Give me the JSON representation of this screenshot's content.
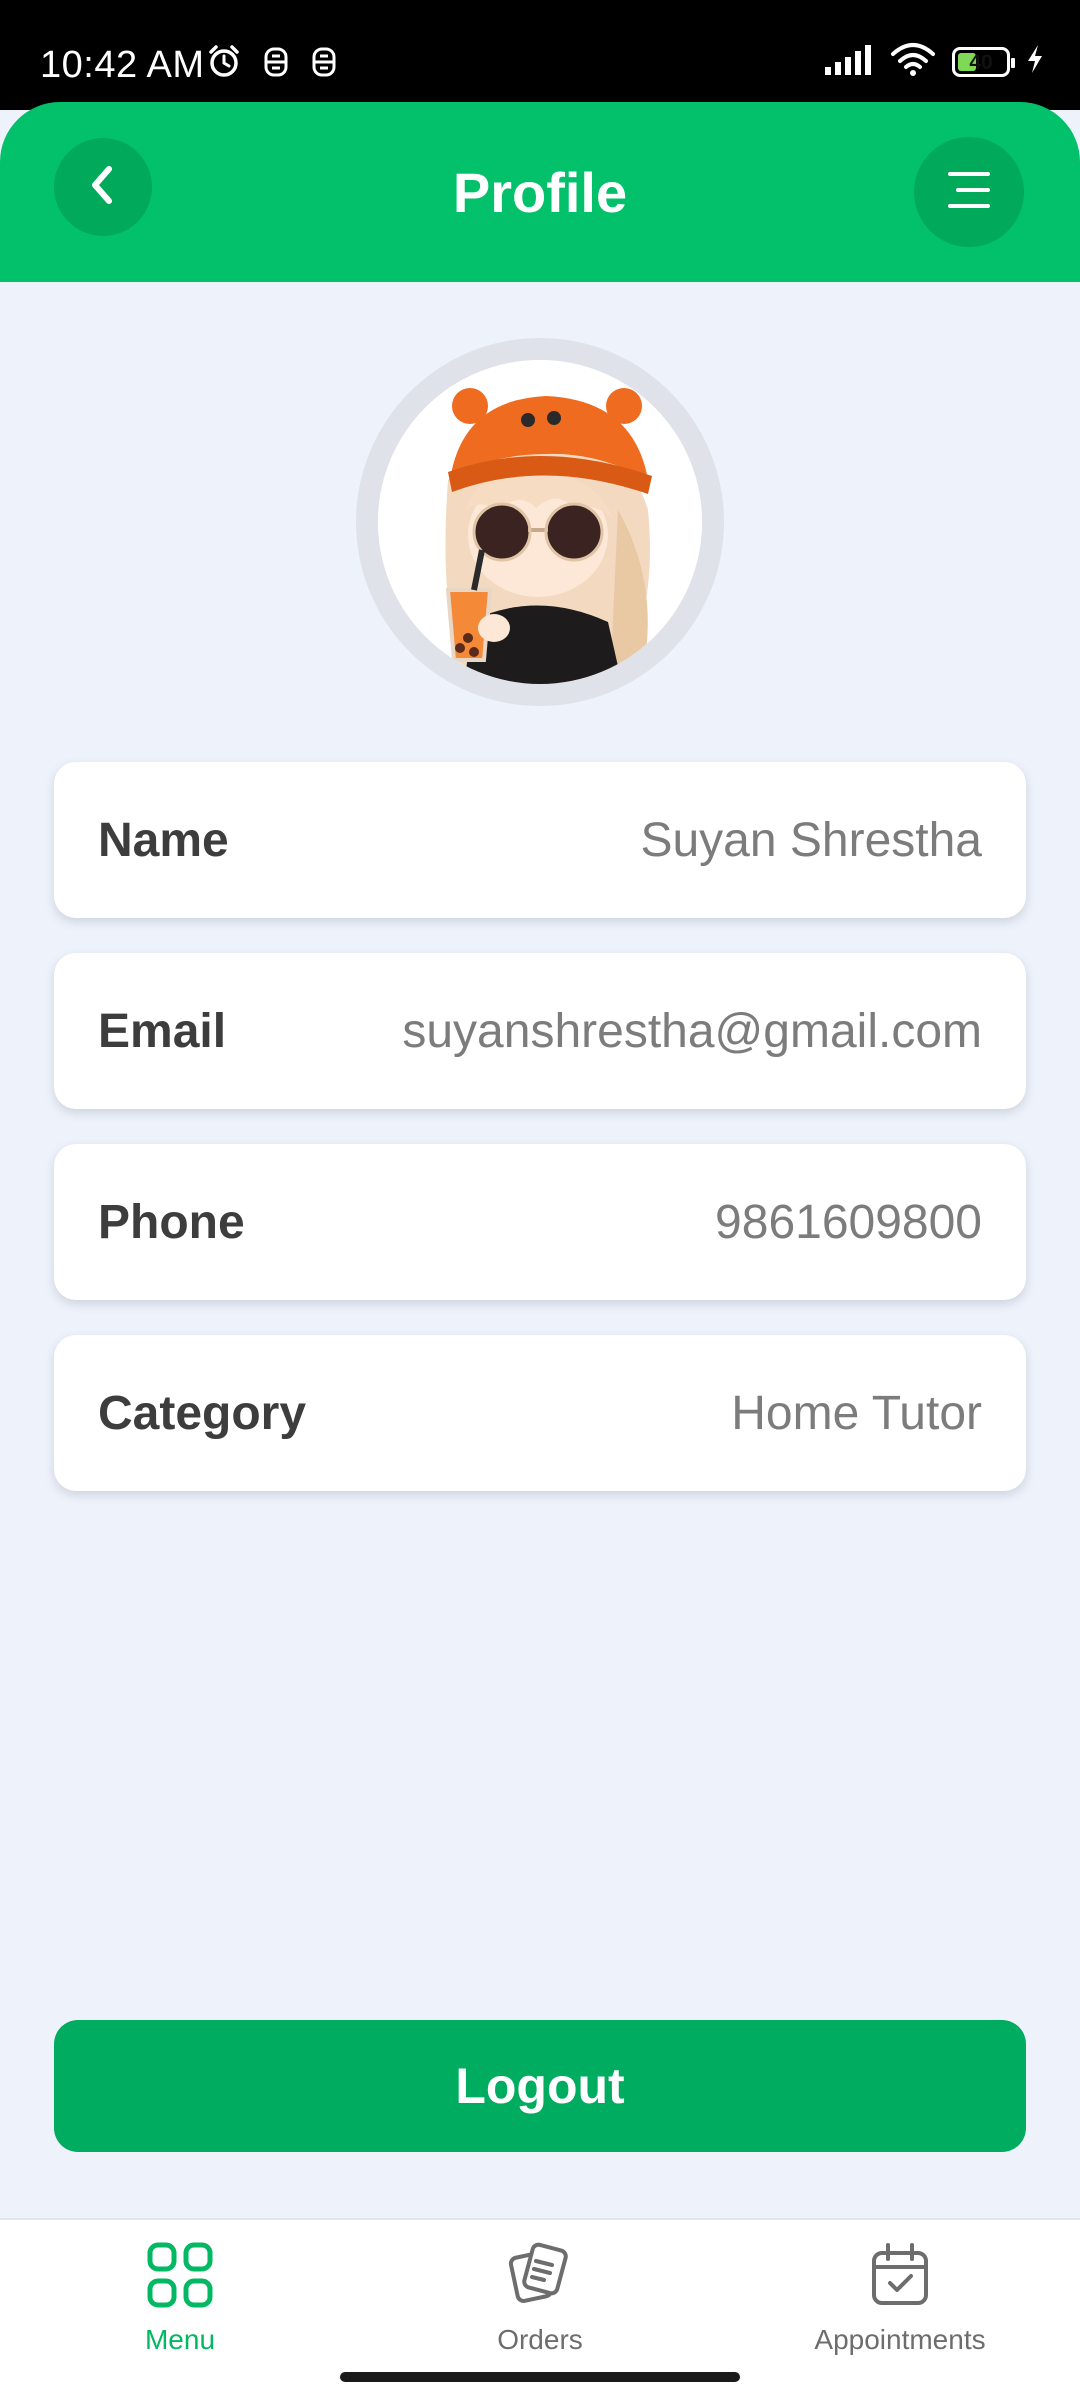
{
  "status_bar": {
    "time": "10:42 AM",
    "battery_level": "40",
    "battery_fraction": 0.4,
    "icons": [
      "alarm-icon",
      "notification-icon",
      "notification-icon",
      "signal-icon",
      "wifi-icon",
      "battery-icon",
      "charging-icon"
    ]
  },
  "header": {
    "title": "Profile",
    "back_icon": "chevron-left-icon",
    "menu_icon": "menu-icon"
  },
  "profile": {
    "avatar": "profile-avatar",
    "fields": {
      "name": {
        "label": "Name",
        "value": "Suyan Shrestha"
      },
      "email": {
        "label": "Email",
        "value": "suyanshrestha@gmail.com"
      },
      "phone": {
        "label": "Phone",
        "value": "9861609800"
      },
      "category": {
        "label": "Category",
        "value": "Home Tutor"
      }
    }
  },
  "logout": {
    "label": "Logout"
  },
  "bottom_nav": {
    "items": [
      {
        "label": "Menu",
        "icon": "grid-icon",
        "active": true
      },
      {
        "label": "Orders",
        "icon": "orders-icon",
        "active": false
      },
      {
        "label": "Appointments",
        "icon": "calendar-check-icon",
        "active": false
      }
    ]
  },
  "colors": {
    "brand_green": "#02c16a",
    "button_green": "#00ac5f",
    "background": "#eef2fb",
    "active_nav": "#02b863"
  }
}
